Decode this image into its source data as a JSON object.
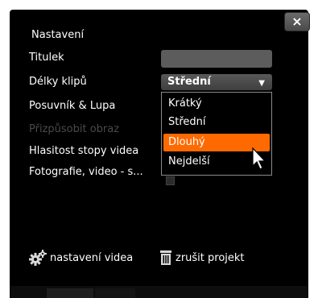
{
  "dialog": {
    "close_label": "×",
    "heading": "Nastavení"
  },
  "settings": {
    "title_label": "Titulek",
    "clip_length_label": "Délky klipů",
    "slider_label": "Posuvník & Lupa",
    "fit_image_label": "Přizpůsobit obraz",
    "track_volume_label": "Hlasitost stopy videa",
    "photo_video_label": "Fotografie, video - s...",
    "title_value": "",
    "clip_length_selected": "Střední"
  },
  "dropdown": {
    "options": [
      "Krátký",
      "Střední",
      "Dlouhý",
      "Nejdelší"
    ],
    "highlighted_index": 2
  },
  "footer": {
    "video_settings_label": "nastavení videa",
    "cancel_project_label": "zrušit projekt"
  },
  "colors": {
    "panel_bg": "#000000",
    "highlight": "#ff6a00",
    "disabled_text": "#4a4a4a"
  }
}
